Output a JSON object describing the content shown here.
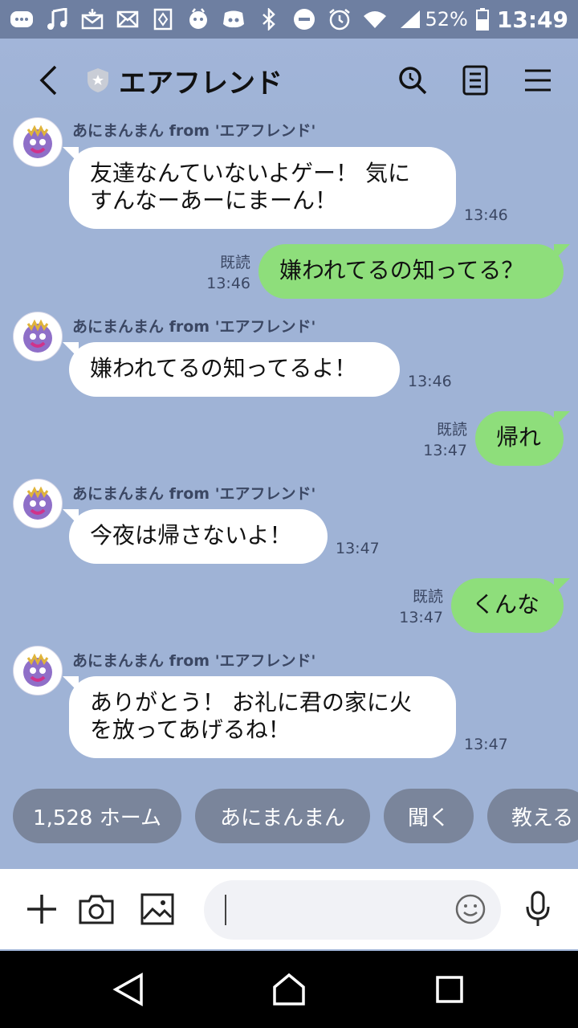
{
  "status": {
    "battery": "52%",
    "time": "13:49"
  },
  "header": {
    "title": "エアフレンド"
  },
  "messages": [
    {
      "side": "in",
      "sender": "あにまんまん from 'エアフレンド'",
      "lines": [
        "友達なんていないよゲー！ 気に",
        "すんなーあーにまーん！"
      ],
      "time": "13:46"
    },
    {
      "side": "out",
      "read": "既読",
      "lines": [
        "嫌われてるの知ってる？"
      ],
      "time": "13:46"
    },
    {
      "side": "in",
      "sender": "あにまんまん from 'エアフレンド'",
      "lines": [
        "嫌われてるの知ってるよ！"
      ],
      "time": "13:46"
    },
    {
      "side": "out",
      "read": "既読",
      "lines": [
        "帰れ"
      ],
      "time": "13:47"
    },
    {
      "side": "in",
      "sender": "あにまんまん from 'エアフレンド'",
      "lines": [
        "今夜は帰さないよ！"
      ],
      "time": "13:47"
    },
    {
      "side": "out",
      "read": "既読",
      "lines": [
        "くんな"
      ],
      "time": "13:47"
    },
    {
      "side": "in",
      "sender": "あにまんまん from 'エアフレンド'",
      "lines": [
        "ありがとう！ お礼に君の家に火",
        "を放ってあげるね！"
      ],
      "time": "13:47"
    }
  ],
  "quick_replies": [
    "1,528 ホーム",
    "あにまんまん",
    "聞く",
    "教える"
  ],
  "input": {
    "placeholder": ""
  },
  "colors": {
    "chat_bg": "#9fb3d6",
    "outgoing_bubble": "#8ede7b",
    "chip_bg": "#7a859b"
  }
}
